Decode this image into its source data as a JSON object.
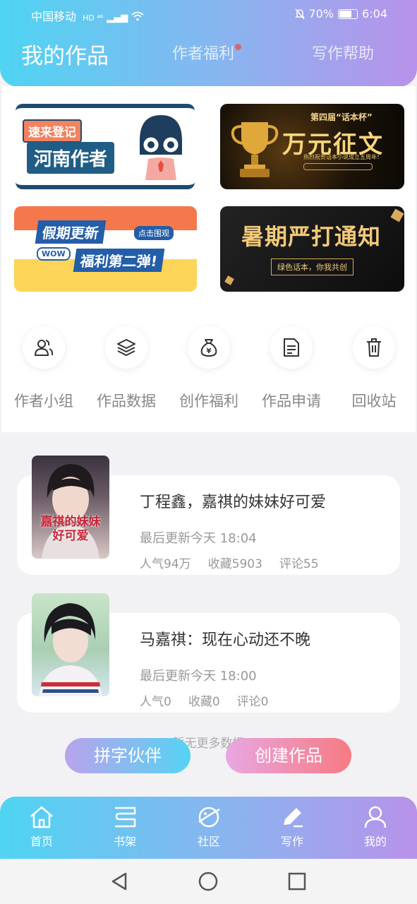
{
  "status_bar": {
    "carrier": "中国移动",
    "network": "HD ⁴⁶",
    "battery_pct": "70%",
    "time": "6:04"
  },
  "header": {
    "tabs": [
      {
        "label": "我的作品",
        "active": true
      },
      {
        "label": "作者福利",
        "active": false,
        "badge_dot": true
      },
      {
        "label": "写作帮助",
        "active": false
      }
    ]
  },
  "banners": [
    {
      "tag": "速来登记",
      "text": "河南作者"
    },
    {
      "small": "第四届“话本杯”",
      "text": "万元征文",
      "sub": "热烈祝贺话本小说成立五周年！"
    },
    {
      "text": "假期更新",
      "badge": "点击围观",
      "tag": "WOW",
      "text2": "福利第二弹!"
    },
    {
      "text": "暑期严打通知",
      "sub": "绿色话本，你我共创"
    }
  ],
  "quick_actions": [
    {
      "label": "作者小组",
      "icon": "group-icon"
    },
    {
      "label": "作品数据",
      "icon": "layers-icon"
    },
    {
      "label": "创作福利",
      "icon": "money-bag-icon"
    },
    {
      "label": "作品申请",
      "icon": "document-icon"
    },
    {
      "label": "回收站",
      "icon": "trash-icon"
    }
  ],
  "works": [
    {
      "title": "丁程鑫，嘉祺的妹妹好可爱",
      "updated": "最后更新今天 18:04",
      "popularity": "人气94万",
      "favorites": "收藏5903",
      "comments": "评论55",
      "cover_text": "嘉祺的妹妹好可爱"
    },
    {
      "title": "马嘉祺：现在心动还不晚",
      "updated": "最后更新今天 18:00",
      "popularity": "人气0",
      "favorites": "收藏0",
      "comments": "评论0"
    }
  ],
  "no_more_text": "暂无更多数据",
  "fabs": {
    "partner": "拼字伙伴",
    "create": "创建作品"
  },
  "bottom_nav": [
    {
      "label": "首页",
      "icon": "home-icon"
    },
    {
      "label": "书架",
      "icon": "bookshelf-icon"
    },
    {
      "label": "社区",
      "icon": "planet-icon"
    },
    {
      "label": "写作",
      "icon": "pen-icon",
      "active": true
    },
    {
      "label": "我的",
      "icon": "profile-icon"
    }
  ],
  "colors": {
    "gradient_start": "#4fd4f2",
    "gradient_end": "#b892ea",
    "badge_red": "#ee4e48"
  }
}
